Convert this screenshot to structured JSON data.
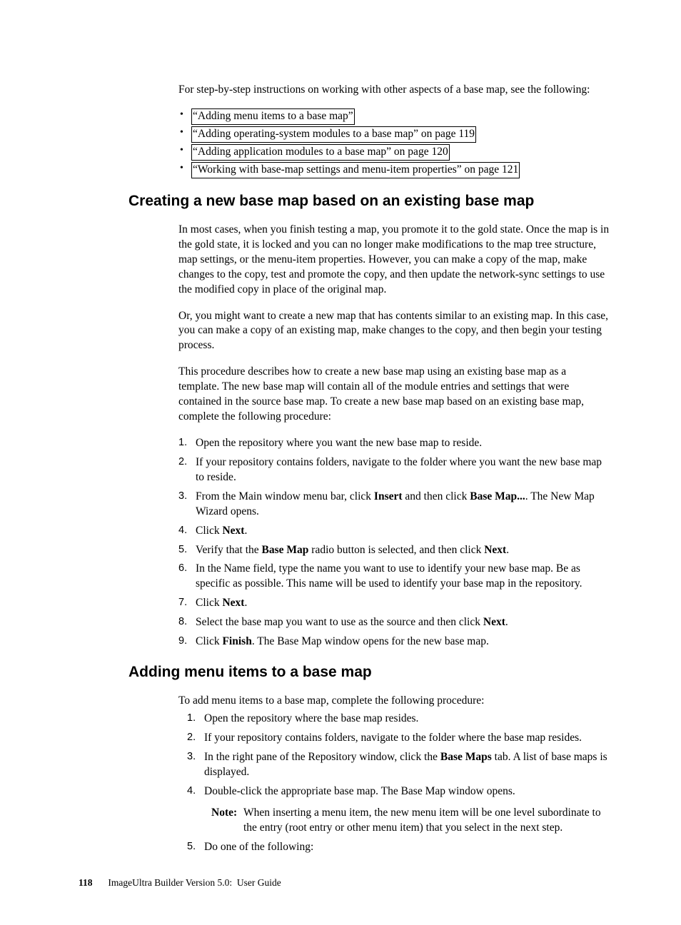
{
  "intro": "For step-by-step instructions on working with other aspects of a base map, see the following:",
  "links": [
    "“Adding menu items to a base map”",
    "“Adding operating-system modules to a base map” on page 119",
    "“Adding application modules to a base map” on page 120",
    "“Working with base-map settings and menu-item properties” on page 121"
  ],
  "s1": {
    "heading": "Creating a new base map based on an existing base map",
    "p1": "In most cases, when you finish testing a map, you promote it to the gold state. Once the map is in the gold state, it is locked and you can no longer make modifications to the map tree structure, map settings, or the menu-item properties. However, you can make a copy of the map, make changes to the copy, test and promote the copy, and then update the network-sync settings to use the modified copy in place of the original map.",
    "p2": "Or, you might want to create a new map that has contents similar to an existing map. In this case, you can make a copy of an existing map, make changes to the copy, and then begin your testing process.",
    "p3": "This procedure describes how to create a new base map using an existing base map as a template. The new base map will contain all of the module entries and settings that were contained in the source base map. To create a new base map based on an existing base map, complete the following procedure:",
    "steps": {
      "n1": "Open the repository where you want the new base map to reside.",
      "n2": "If your repository contains folders, navigate to the folder where you want the new base map to reside.",
      "n3a": "From the Main window menu bar, click ",
      "n3b": "Insert",
      "n3c": " and then click ",
      "n3d": "Base Map...",
      "n3e": ". The New Map Wizard opens.",
      "n4a": "Click ",
      "n4b": "Next",
      "n4c": ".",
      "n5a": "Verify that the ",
      "n5b": "Base Map",
      "n5c": " radio button is selected, and then click ",
      "n5d": "Next",
      "n5e": ".",
      "n6": "In the Name field, type the name you want to use to identify your new base map. Be as specific as possible. This name will be used to identify your base map in the repository.",
      "n7a": "Click ",
      "n7b": "Next",
      "n7c": ".",
      "n8a": "Select the base map you want to use as the source and then click ",
      "n8b": "Next",
      "n8c": ".",
      "n9a": "Click ",
      "n9b": "Finish",
      "n9c": ". The Base Map window opens for the new base map."
    }
  },
  "s2": {
    "heading": "Adding menu items to a base map",
    "p1": "To add menu items to a base map, complete the following procedure:",
    "steps": {
      "n1": "Open the repository where the base map resides.",
      "n2": "If your repository contains folders, navigate to the folder where the base map resides.",
      "n3a": "In the right pane of the Repository window, click the ",
      "n3b": "Base Maps",
      "n3c": " tab. A list of base maps is displayed.",
      "n4": "Double-click the appropriate base map. The Base Map window opens.",
      "noteLabel": "Note:",
      "noteText": "When inserting a menu item, the new menu item will be one level subordinate to the entry (root entry or other menu item) that you select in the next step.",
      "n5": "Do one of the following:"
    }
  },
  "footer": {
    "page": "118",
    "title": "ImageUltra Builder Version 5.0: User Guide"
  }
}
